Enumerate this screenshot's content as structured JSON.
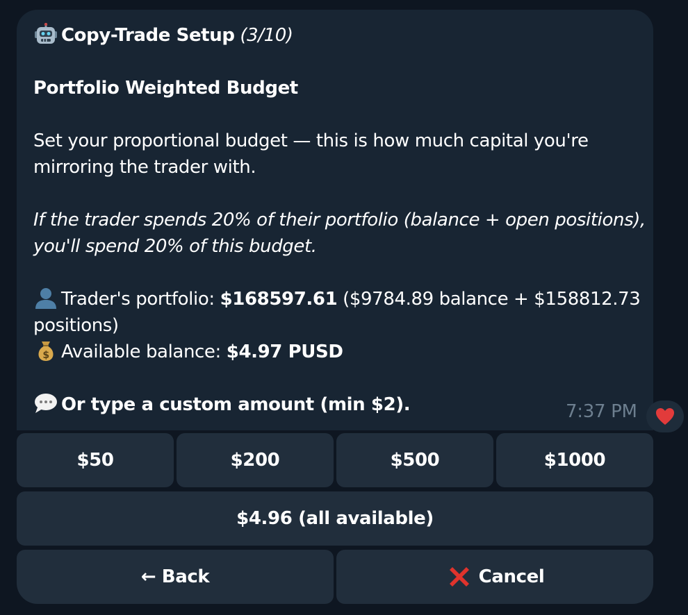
{
  "message": {
    "header": {
      "title": "Copy-Trade Setup",
      "step": "(3/10)",
      "icon": "robot-icon"
    },
    "section_title": "Portfolio Weighted Budget",
    "description_line1": "Set your proportional budget — this is how much capital you're",
    "description_line2": "mirroring the trader with.",
    "italic_line1": "If the trader spends 20% of their portfolio (balance + open positions),",
    "italic_line2": "you'll spend 20% of this budget.",
    "portfolio": {
      "icon": "user-silhouette-icon",
      "label": "Trader's portfolio: ",
      "value": "$168597.61",
      "detail": " ($9784.89 balance + $158812.73",
      "detail_cont": "positions)"
    },
    "balance": {
      "icon": "money-bag-icon",
      "label": "Available balance: ",
      "value": "$4.97 PUSD"
    },
    "custom": {
      "icon": "speech-bubble-icon",
      "text": "Or type a custom amount (min $2)."
    },
    "time": "7:37 PM",
    "reaction": "red-heart-icon"
  },
  "keyboard": {
    "amounts": [
      "$50",
      "$200",
      "$500",
      "$1000"
    ],
    "all_available": "$4.96 (all available)",
    "back": "← Back",
    "cancel": "Cancel",
    "cancel_icon": "cross-mark-icon"
  },
  "colors": {
    "background": "#0e1621",
    "bubble": "#182533",
    "button": "#212e3c",
    "timestamp": "#6d7f8f",
    "cancel_icon": "#e0332c"
  }
}
